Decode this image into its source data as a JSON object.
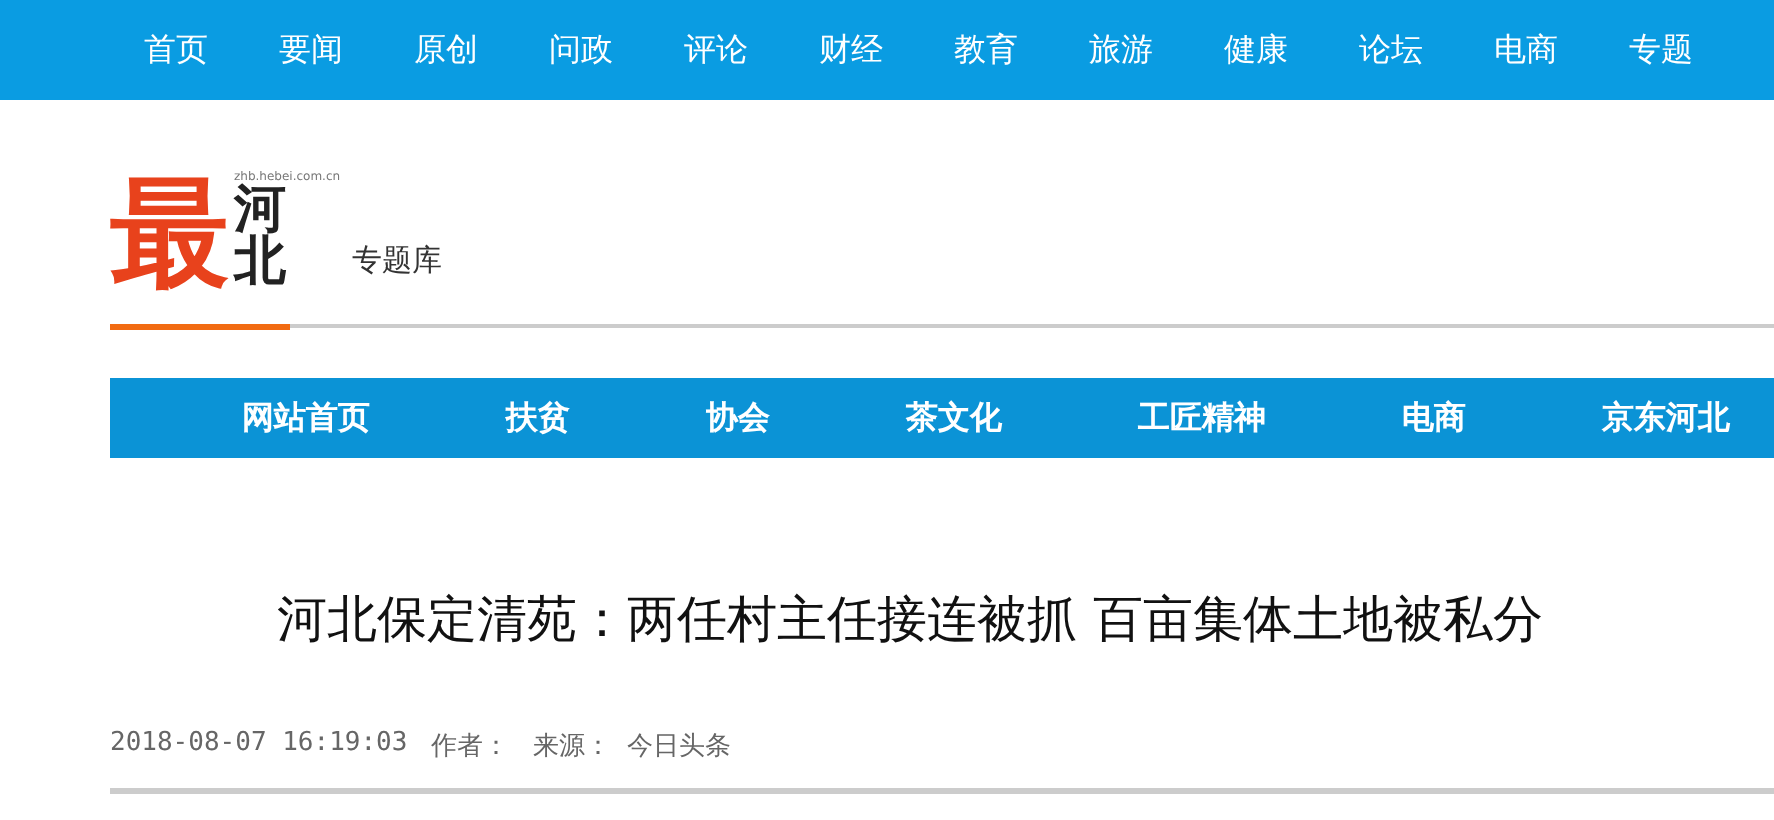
{
  "top_nav": [
    {
      "label": "首页"
    },
    {
      "label": "要闻"
    },
    {
      "label": "原创"
    },
    {
      "label": "问政"
    },
    {
      "label": "评论"
    },
    {
      "label": "财经"
    },
    {
      "label": "教育"
    },
    {
      "label": "旅游"
    },
    {
      "label": "健康"
    },
    {
      "label": "论坛"
    },
    {
      "label": "电商"
    },
    {
      "label": "专题"
    }
  ],
  "logo": {
    "mark": "最",
    "name": "河北",
    "url": "zhb.hebei.com.cn",
    "subtitle": "专题库"
  },
  "section_nav": [
    {
      "label": "网站首页"
    },
    {
      "label": "扶贫"
    },
    {
      "label": "协会"
    },
    {
      "label": "茶文化"
    },
    {
      "label": "工匠精神"
    },
    {
      "label": "电商"
    },
    {
      "label": "京东河北"
    }
  ],
  "article": {
    "title": "河北保定清苑：两任村主任接连被抓 百亩集体土地被私分",
    "date": "2018-08-07 16:19:03",
    "author_label": "作者：",
    "source_label": "来源：",
    "source": "今日头条"
  }
}
